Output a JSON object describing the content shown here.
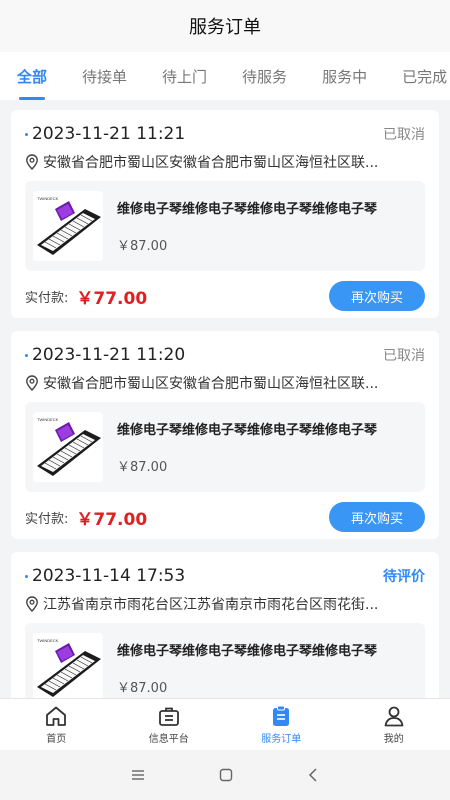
{
  "header": {
    "title": "服务订单"
  },
  "tabs": [
    {
      "label": "全部",
      "active": true
    },
    {
      "label": "待接单"
    },
    {
      "label": "待上门"
    },
    {
      "label": "待服务"
    },
    {
      "label": "服务中"
    },
    {
      "label": "已完成"
    }
  ],
  "orders": [
    {
      "time": "2023-11-21 11:21",
      "status": "已取消",
      "address": "安徽省合肥市蜀山区安徽省合肥市蜀山区海恒社区联...",
      "product_name": "维修电子琴维修电子琴维修电子琴维修电子琴",
      "product_price": "￥87.00",
      "paid_label": "实付款:",
      "paid_amount": "￥77.00",
      "button_label": "再次购买"
    },
    {
      "time": "2023-11-21 11:20",
      "status": "已取消",
      "address": "安徽省合肥市蜀山区安徽省合肥市蜀山区海恒社区联...",
      "product_name": "维修电子琴维修电子琴维修电子琴维修电子琴",
      "product_price": "￥87.00",
      "paid_label": "实付款:",
      "paid_amount": "￥77.00",
      "button_label": "再次购买"
    },
    {
      "time": "2023-11-14 17:53",
      "status": "待评价",
      "address": "江苏省南京市雨花台区江苏省南京市雨花台区雨花街...",
      "product_name": "维修电子琴维修电子琴维修电子琴维修电子琴",
      "product_price": "￥87.00"
    }
  ],
  "thumb_brand": "TWINDECK",
  "tabbar": [
    {
      "label": "首页",
      "icon": "home-icon"
    },
    {
      "label": "信息平台",
      "icon": "briefcase-icon"
    },
    {
      "label": "服务订单",
      "icon": "clipboard-icon",
      "active": true
    },
    {
      "label": "我的",
      "icon": "user-icon"
    }
  ],
  "colors": {
    "accent": "#2f8af5",
    "price": "#e02020",
    "button": "#3a96f5"
  }
}
